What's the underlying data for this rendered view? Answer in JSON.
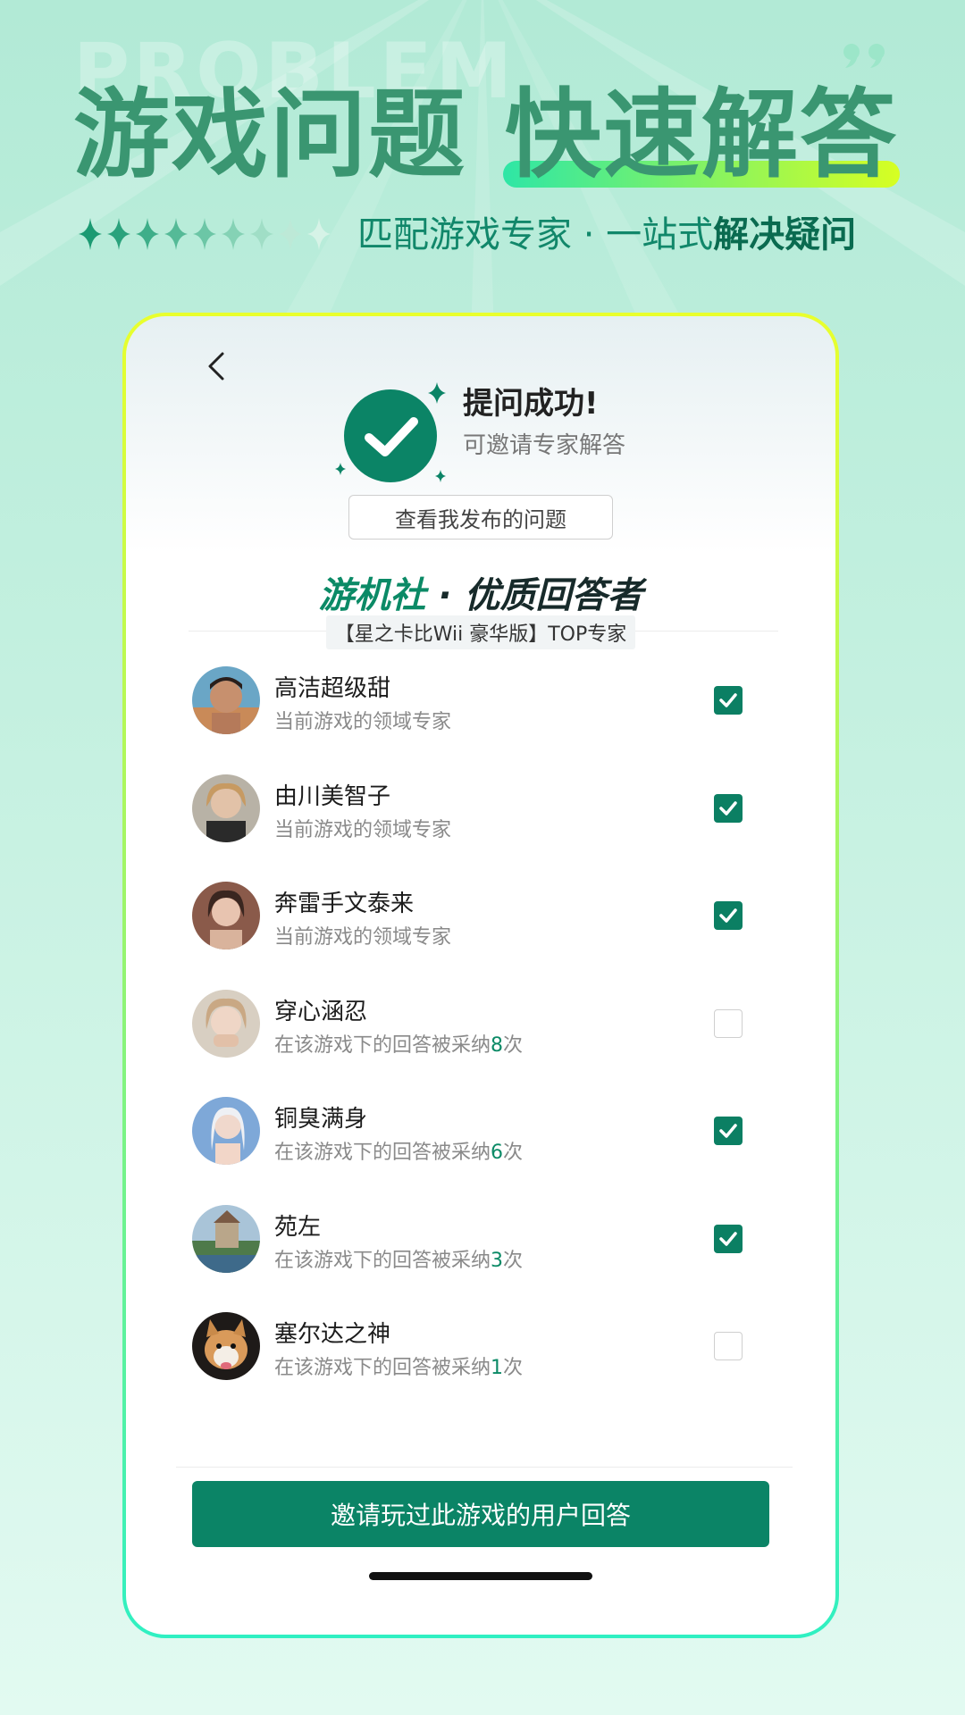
{
  "background_word": "PROBLEM",
  "headline": {
    "part1": "游戏问题",
    "part2": "快速解答"
  },
  "tagline": {
    "normal": "匹配游戏专家 · 一站式",
    "bold": "解决疑问"
  },
  "colors": {
    "accent_green": "#0b8466",
    "headline_green": "#3a9671",
    "underline_gradient": [
      "#2ee6a6",
      "#d7ff22"
    ]
  },
  "screen": {
    "back_icon": "chevron-left-icon",
    "success_title": "提问成功!",
    "success_subtitle": "可邀请专家解答",
    "view_button": "查看我发布的问题",
    "club_title_green": "游机社",
    "club_title_dark": " · 优质回答者",
    "top_label": "【星之卡比Wii 豪华版】TOP专家",
    "experts": [
      {
        "name": "高洁超级甜",
        "desc_prefix": "当前游戏的领域专家",
        "count": "",
        "desc_suffix": "",
        "checked": true
      },
      {
        "name": "由川美智子",
        "desc_prefix": "当前游戏的领域专家",
        "count": "",
        "desc_suffix": "",
        "checked": true
      },
      {
        "name": "奔雷手文泰来",
        "desc_prefix": "当前游戏的领域专家",
        "count": "",
        "desc_suffix": "",
        "checked": true
      },
      {
        "name": "穿心涵忍",
        "desc_prefix": "在该游戏下的回答被采纳",
        "count": "8",
        "desc_suffix": "次",
        "checked": false
      },
      {
        "name": "铜臭满身",
        "desc_prefix": "在该游戏下的回答被采纳",
        "count": "6",
        "desc_suffix": "次",
        "checked": true
      },
      {
        "name": "苑左",
        "desc_prefix": "在该游戏下的回答被采纳",
        "count": "3",
        "desc_suffix": "次",
        "checked": true
      },
      {
        "name": "塞尔达之神",
        "desc_prefix": "在该游戏下的回答被采纳",
        "count": "1",
        "desc_suffix": "次",
        "checked": false
      }
    ],
    "invite_button": "邀请玩过此游戏的用户回答"
  }
}
